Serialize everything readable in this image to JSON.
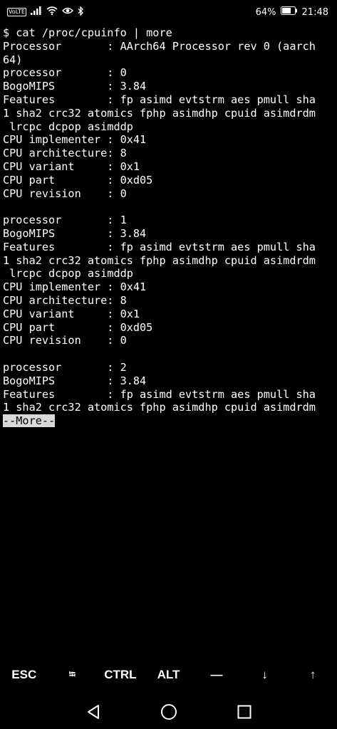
{
  "status_bar": {
    "network_label": "VoLTE",
    "battery_percent": "64%",
    "time": "21:48",
    "icons": [
      "volte-icon",
      "signal-icon",
      "wifi-icon",
      "eye-icon",
      "bluetooth-icon",
      "battery-icon"
    ]
  },
  "terminal": {
    "lines": [
      "$ cat /proc/cpuinfo | more",
      "Processor       : AArch64 Processor rev 0 (aarch",
      "64)",
      "processor       : 0",
      "BogoMIPS        : 3.84",
      "Features        : fp asimd evtstrm aes pmull sha",
      "1 sha2 crc32 atomics fphp asimdhp cpuid asimdrdm",
      " lrcpc dcpop asimddp",
      "CPU implementer : 0x41",
      "CPU architecture: 8",
      "CPU variant     : 0x1",
      "CPU part        : 0xd05",
      "CPU revision    : 0",
      "",
      "processor       : 1",
      "BogoMIPS        : 3.84",
      "Features        : fp asimd evtstrm aes pmull sha",
      "1 sha2 crc32 atomics fphp asimdhp cpuid asimdrdm",
      " lrcpc dcpop asimddp",
      "CPU implementer : 0x41",
      "CPU architecture: 8",
      "CPU variant     : 0x1",
      "CPU part        : 0xd05",
      "CPU revision    : 0",
      "",
      "processor       : 2",
      "BogoMIPS        : 3.84",
      "Features        : fp asimd evtstrm aes pmull sha",
      "1 sha2 crc32 atomics fphp asimdhp cpuid asimdrdm"
    ],
    "more_prompt": "--More--"
  },
  "extra_keys": [
    "ESC",
    "⭾",
    "CTRL",
    "ALT",
    "—",
    "↓",
    "↑"
  ],
  "nav_bar": {
    "icons": [
      "back-icon",
      "home-icon",
      "recents-icon"
    ]
  }
}
